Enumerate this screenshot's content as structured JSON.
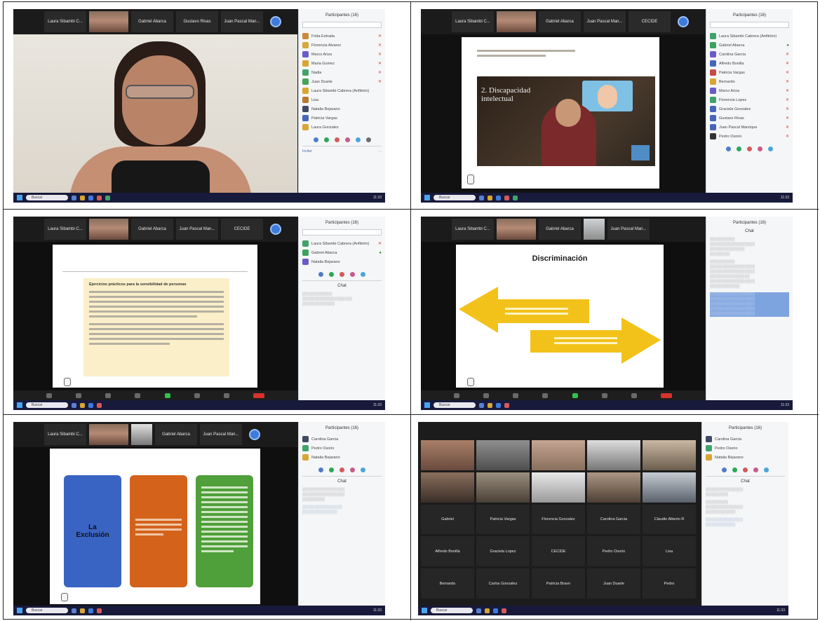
{
  "panels": [
    {
      "id": "p1",
      "strip_names": [
        "Laura Sibambi C...",
        "",
        "Gabriel Abarca",
        "Gustavo Rivas",
        "Juan Pascal Man..."
      ],
      "panel_title": "Participantes (16)",
      "participants": [
        "Frida Estrada",
        "Florencia Alvarez",
        "Marco Ariza",
        "Maria Gomez",
        "Nadia",
        "Juan Duarte",
        "Laura Sibambi Cabrera (Anfitrión)",
        "Lisa",
        "Natalia Bejarano",
        "Patricia Vargas",
        "Laura Gonzalez"
      ],
      "status": "Invitar"
    },
    {
      "id": "p2",
      "strip_names": [
        "Laura Sibambi C...",
        "",
        "Gabriel Abarca",
        "Juan Pascal Man...",
        "CECIDE"
      ],
      "panel_title": "Participantes (16)",
      "slide_heading": "2. Discapacidad intelectual",
      "participants": [
        "Laura Sibambi Cabrera (Anfitrión)",
        "Gabriel Abarca",
        "Carolina Garcia",
        "Alfredo Bonilla",
        "Patricia Vargas",
        "Bernardo",
        "Marco Ariza",
        "Florencia Lopez",
        "Graciela Gonzalez",
        "Gustavo Rivas",
        "Juan Pascal Manrique",
        "Pedro Osorio"
      ]
    },
    {
      "id": "p3",
      "strip_names": [
        "Laura Sibambi C...",
        "",
        "Gabriel Abarca",
        "Juan Pascal Man...",
        "CECIDE"
      ],
      "panel_title": "Participantes (16)",
      "slide_heading": "Ejercicios prácticos para la sensibilidad de personas",
      "participants": [
        "Laura Sibambi Cabrera (Anfitrión)",
        "Gabriel Abarca",
        "Natalia Bejarano"
      ],
      "chat_title": "Chat"
    },
    {
      "id": "p4",
      "strip_names": [
        "Laura Sibambi C...",
        "",
        "Gabriel Abarca",
        "",
        "Juan Pascal Man..."
      ],
      "panel_title": "Participantes (16)",
      "slide_heading": "Discriminación",
      "chat_title": "Chat"
    },
    {
      "id": "p5",
      "strip_names": [
        "Laura Sibambi C...",
        "",
        "",
        "Gabriel Abarca",
        "Juan Pascal Man..."
      ],
      "panel_title": "Participantes (16)",
      "slide_heading": "La Exclusión",
      "participants": [
        "Carolina Garcia",
        "Pedro Osorio",
        "Natalia Bejarano"
      ],
      "chat_title": "Chat"
    },
    {
      "id": "p6",
      "panel_title": "Participantes (16)",
      "tile_names": [
        "Gabriel",
        "Patricia Vargas",
        "Florencia Gonzalez",
        "Carolina Garcia",
        "Claudio Alberto R",
        "Alfredo Bonilla",
        "Graciela Lopez",
        "CECIDE",
        "Pedro Osorio",
        "Lisa",
        "Bernardo",
        "Carlos Gonzalez",
        "Patricia Bravo",
        "Juan Duarte",
        "Pedro"
      ],
      "participants": [
        "Carolina Garcia",
        "Pedro Osorio",
        "Natalia Bejarano"
      ],
      "chat_title": "Chat"
    }
  ],
  "taskbar": {
    "search_placeholder": "Buscar",
    "clock": "11:33"
  },
  "colors": {
    "zoom_blue": "#3d7bdc",
    "exclusion_blue": "#3a64c4",
    "exclusion_orange": "#d4621b",
    "exclusion_green": "#4f9f3a",
    "arrow_yellow": "#f2c21a",
    "taskbar": "#171a3a"
  }
}
